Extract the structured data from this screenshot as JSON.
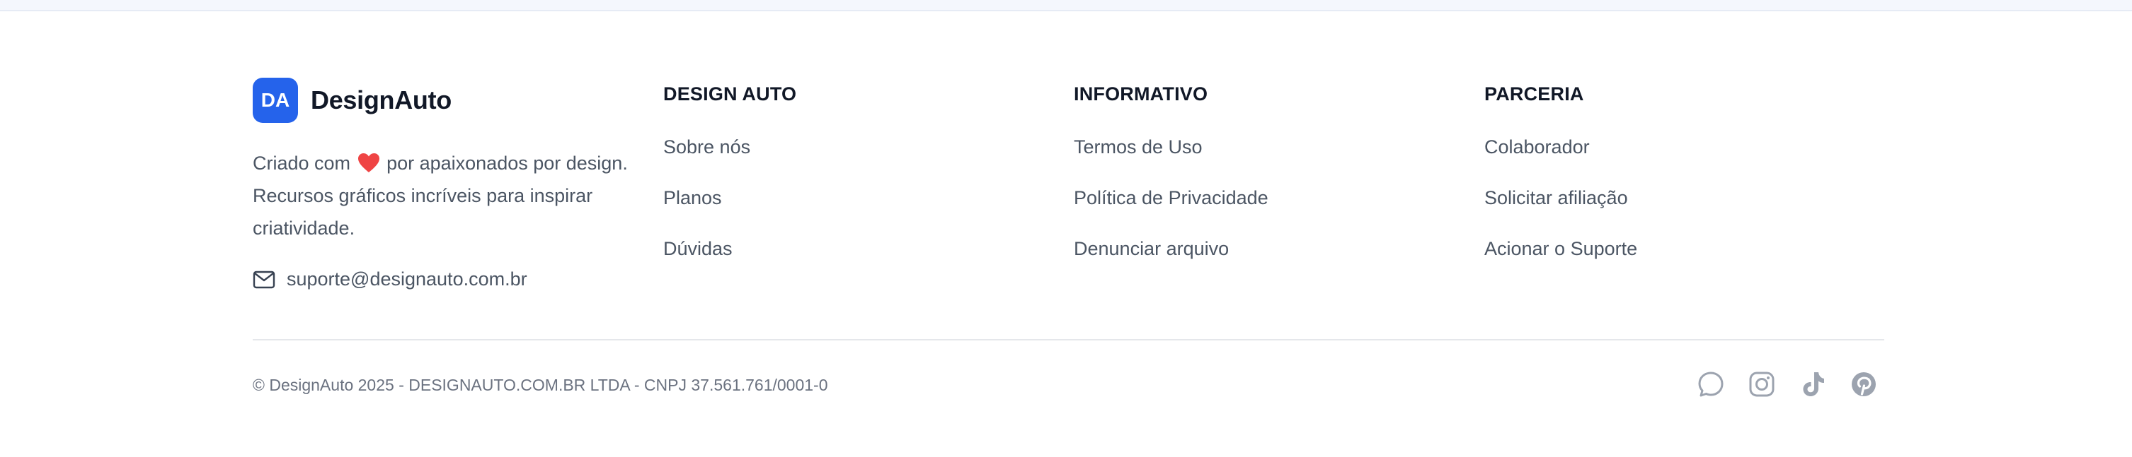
{
  "brand": {
    "logo_text": "DA",
    "name": "DesignAuto",
    "desc_before": "Criado com",
    "desc_after": "por apaixonados por design. Recursos gráficos incríveis para inspirar criatividade.",
    "email": "suporte@designauto.com.br"
  },
  "columns": [
    {
      "title": "DESIGN AUTO",
      "links": [
        "Sobre nós",
        "Planos",
        "Dúvidas"
      ]
    },
    {
      "title": "INFORMATIVO",
      "links": [
        "Termos de Uso",
        "Política de Privacidade",
        "Denunciar arquivo"
      ]
    },
    {
      "title": "PARCERIA",
      "links": [
        "Colaborador",
        "Solicitar afiliação",
        "Acionar o Suporte"
      ]
    }
  ],
  "footer": {
    "copyright": "© DesignAuto 2025 - DESIGNAUTO.COM.BR LTDA - CNPJ 37.561.761/0001-0"
  },
  "socials": [
    "whatsapp-icon",
    "instagram-icon",
    "tiktok-icon",
    "pinterest-icon"
  ],
  "colors": {
    "brand_blue": "#2563eb",
    "heart_red": "#ef4444",
    "social_gray": "#9ca3af"
  }
}
